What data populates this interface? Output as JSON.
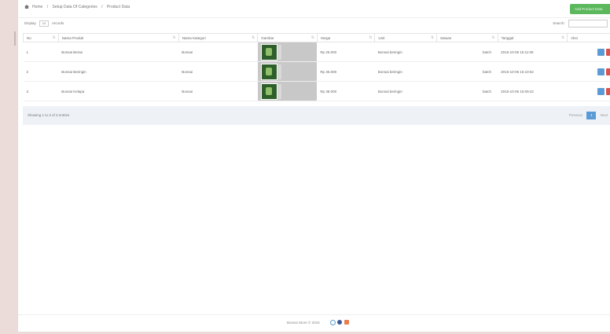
{
  "breadcrumb": {
    "home": "Home",
    "section": "Setup Data Of Categories",
    "current": "Product Data"
  },
  "header": {
    "add_button": "Add Product Data"
  },
  "controls": {
    "display_label": "Display",
    "display_value": "10",
    "records_label": "records",
    "search_label": "Search:"
  },
  "table": {
    "headers": [
      "No",
      "Nama Produk",
      "Nama Kategori",
      "Gambar",
      "Harga",
      "Unit",
      "Satuan",
      "Tanggal",
      "Aksi"
    ],
    "rows": [
      [
        "1",
        "Bonsai Beras",
        "Bonsai",
        "",
        "Rp 25.000",
        "Bonsai beringin",
        "batch",
        "2015-10-06 15:11:06"
      ],
      [
        "2",
        "Bonsai Beringin",
        "Bonsai",
        "",
        "Rp 35.000",
        "Bonsai beringin",
        "batch",
        "2015-10-06 15:10:52"
      ],
      [
        "3",
        "Bonsai Kelapa",
        "Bonsai",
        "",
        "Rp 38.000",
        "Bonsai beringin",
        "batch",
        "2015-10-06 15:09:42"
      ]
    ]
  },
  "info": "Showing 1 to 3 of 3 entries",
  "pager": {
    "prev": "Previous",
    "page": "1",
    "next": "Next"
  },
  "footer": {
    "copyright": "Bonsai Store © 2015"
  },
  "colors": {
    "add_button": "#5cb85c",
    "edit_button": "#5b9bd5",
    "delete_button": "#d9534f",
    "background": "#ecdcd9"
  }
}
